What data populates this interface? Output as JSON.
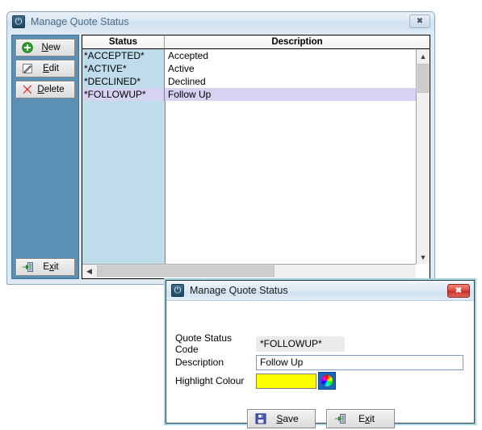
{
  "parent_window": {
    "title": "Manage Quote Status",
    "app_icon": "power-icon",
    "close_label": "✖",
    "toolbar": [
      {
        "label_pre": "",
        "label_key": "N",
        "label_post": "ew",
        "icon": "add-circle-icon",
        "name": "new"
      },
      {
        "label_pre": "",
        "label_key": "E",
        "label_post": "dit",
        "icon": "pencil-edit-icon",
        "name": "edit"
      },
      {
        "label_pre": "",
        "label_key": "D",
        "label_post": "elete",
        "icon": "red-x-icon",
        "name": "delete"
      }
    ],
    "exit_button": {
      "pre": "E",
      "key": "x",
      "post": "it",
      "icon": "exit-door-icon"
    },
    "grid": {
      "columns": [
        "Status",
        "Description"
      ],
      "rows": [
        {
          "status": "*ACCEPTED*",
          "description": "Accepted",
          "selected": false
        },
        {
          "status": "*ACTIVE*",
          "description": "Active",
          "selected": false
        },
        {
          "status": "*DECLINED*",
          "description": "Declined",
          "selected": false
        },
        {
          "status": "*FOLLOWUP*",
          "description": "Follow Up",
          "selected": true
        }
      ],
      "scroll_up_icon": "chevron-up-icon",
      "scroll_down_icon": "chevron-down-icon",
      "scroll_left_icon": "chevron-left-icon"
    }
  },
  "child_window": {
    "title": "Manage Quote Status",
    "app_icon": "power-icon",
    "close_label": "✖",
    "fields": {
      "code_label": "Quote Status Code",
      "code_value": "*FOLLOWUP*",
      "description_label": "Description",
      "description_value": "Follow Up",
      "colour_label": "Highlight Colour",
      "colour_value": "#ffff00",
      "colour_picker_icon": "colour-wheel-icon"
    },
    "save_button": {
      "pre": "",
      "key": "S",
      "post": "ave",
      "icon": "floppy-save-icon"
    },
    "exit_button": {
      "pre": "E",
      "key": "x",
      "post": "it",
      "icon": "exit-door-icon"
    }
  },
  "colors": {
    "panel_blue": "#5b8fb4",
    "status_column": "#bfdcea",
    "selected_row": "#d5d2f2",
    "highlight_yellow": "#ffff00"
  }
}
